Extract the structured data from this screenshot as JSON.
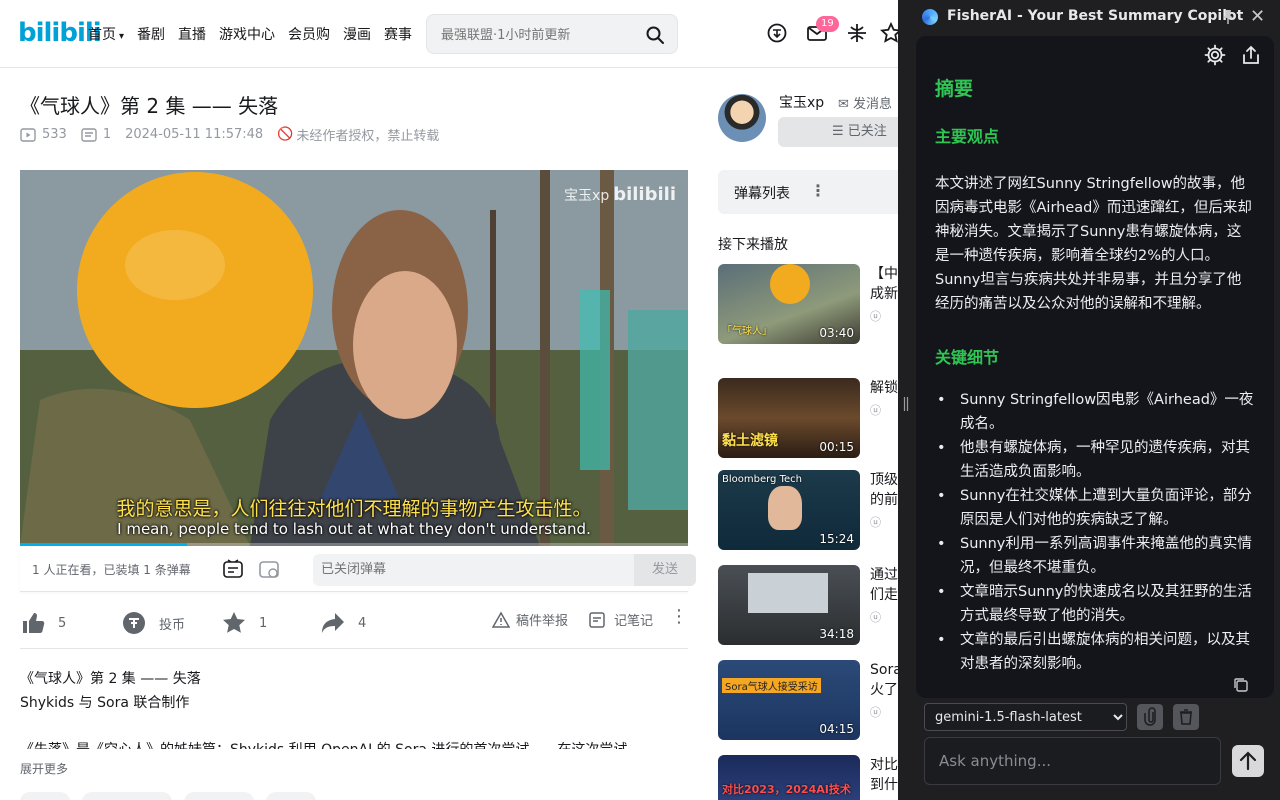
{
  "header": {
    "logo": "bilibili",
    "nav": [
      "首页",
      "番剧",
      "直播",
      "游戏中心",
      "会员购",
      "漫画",
      "赛事"
    ],
    "search_placeholder": "最强联盟·1小时前更新",
    "notif_count": "19"
  },
  "video": {
    "title": "《气球人》第 2 集 —— 失落",
    "views": "533",
    "danmaku_count": "1",
    "datetime": "2024-05-11 11:57:48",
    "copyright": "未经作者授权，禁止转载",
    "watermark_user": "宝玉xp",
    "watermark_brand": "bilibili",
    "subtitle_cn": "我的意思是，人们往往对他们不理解的事物产生攻击性。",
    "subtitle_en": "I mean, people tend to lash out at what they don't understand.",
    "progress": 0.25
  },
  "danmaku_bar": {
    "watching": "1 人正在看，已装填 1 条弹幕",
    "input_placeholder": "已关闭弹幕",
    "send_label": "发送"
  },
  "actions": {
    "like": "5",
    "coin": "投币",
    "fav": "1",
    "share": "4",
    "report": "稿件举报",
    "note": "记笔记"
  },
  "description": {
    "line1": "《气球人》第 2 集 —— 失落",
    "line2": "Shykids 与 Sora 联合制作",
    "line3": "《失落》是《空心人》的姊妹篇：Shykids 利用 OpenAI 的 Sora 进行的首次尝试……在这次尝试",
    "expand": "展开更多"
  },
  "uploader": {
    "name": "宝玉xp",
    "message": "发消息",
    "follow": "已关注"
  },
  "sidebar": {
    "danmaku_list": "弹幕列表",
    "next_play": "接下来播放",
    "recommendations": [
      {
        "title": "【中",
        "title2": "成新",
        "duration": "03:40",
        "caption": "「气球人」"
      },
      {
        "title": "解锁",
        "title2": "",
        "duration": "00:15",
        "caption": "黏土滤镜"
      },
      {
        "title": "顶级",
        "title2": "的前",
        "duration": "15:24",
        "caption": "Bloomberg Tech"
      },
      {
        "title": "通过",
        "title2": "们走",
        "duration": "34:18",
        "caption": ""
      },
      {
        "title": "Sora",
        "title2": "火了",
        "duration": "04:15",
        "caption": "Sora气球人接受采访"
      },
      {
        "title": "对比",
        "title2": "到什",
        "duration": "",
        "caption": "对比2023，2024AI技术"
      }
    ]
  },
  "extension": {
    "title": "FisherAI - Your Best Summary Copilot",
    "summary_title": "摘要",
    "main_points_title": "主要观点",
    "main_points": "本文讲述了网红Sunny Stringfellow的故事，他因病毒式电影《Airhead》而迅速蹿红，但后来却神秘消失。文章揭示了Sunny患有螺旋体病，这是一种遗传疾病，影响着全球约2%的人口。Sunny坦言与疾病共处并非易事，并且分享了他经历的痛苦以及公众对他的误解和不理解。",
    "details_title": "关键细节",
    "details": [
      "Sunny Stringfellow因电影《Airhead》一夜成名。",
      "他患有螺旋体病，一种罕见的遗传疾病，对其生活造成负面影响。",
      "Sunny在社交媒体上遭到大量负面评论，部分原因是人们对他的疾病缺乏了解。",
      "Sunny利用一系列高调事件来掩盖他的真实情况，但最终不堪重负。",
      "文章暗示Sunny的快速成名以及其狂野的生活方式最终导致了他的消失。",
      "文章的最后引出螺旋体病的相关问题，以及其对患者的深刻影响。"
    ],
    "model": "gemini-1.5-flash-latest",
    "ask_placeholder": "Ask anything..."
  }
}
